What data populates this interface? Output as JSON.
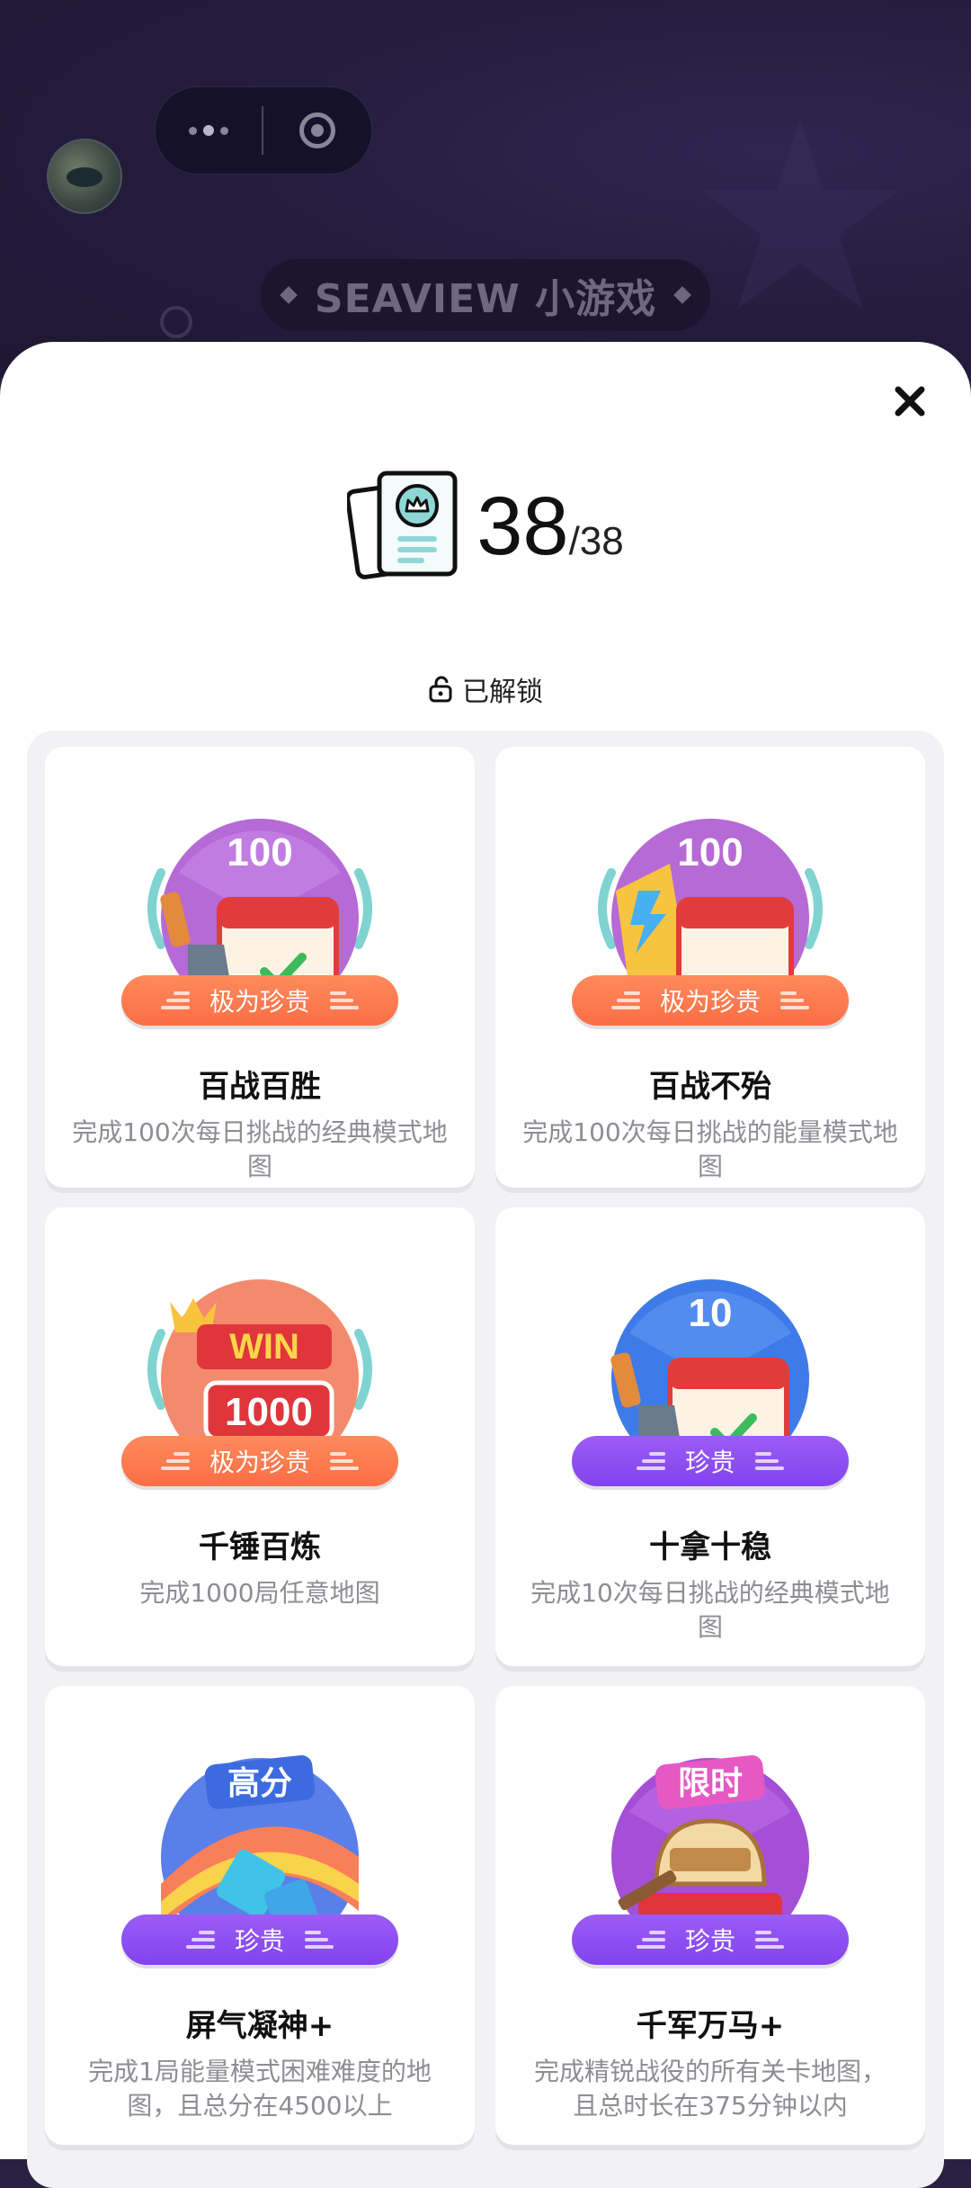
{
  "header": {
    "game_title": "SEAVIEW 小游戏"
  },
  "sheet": {
    "progress": {
      "unlocked": "38",
      "total": "/38"
    },
    "filter_label": "已解锁"
  },
  "achievements": [
    {
      "name": "百战百胜",
      "desc": "完成100次每日挑战的经典模式地图",
      "rarity": "极为珍贵",
      "badge_label": "100",
      "color": "#fb6e45"
    },
    {
      "name": "百战不殆",
      "desc": "完成100次每日挑战的能量模式地图",
      "rarity": "极为珍贵",
      "badge_label": "100",
      "color": "#fb6e45"
    },
    {
      "name": "千锤百炼",
      "desc": "完成1000局任意地图",
      "rarity": "极为珍贵",
      "badge_label": "1000",
      "badge_label2": "WIN",
      "color": "#fb6e45"
    },
    {
      "name": "十拿十稳",
      "desc": "完成10次每日挑战的经典模式地图",
      "rarity": "珍贵",
      "badge_label": "10",
      "color": "#8243ee"
    },
    {
      "name": "屏气凝神+",
      "desc": "完成1局能量模式困难难度的地图，且总分在4500以上",
      "rarity": "珍贵",
      "badge_label": "高分",
      "color": "#8243ee"
    },
    {
      "name": "千军万马+",
      "desc": "完成精锐战役的所有关卡地图，且总时长在375分钟以内",
      "rarity": "珍贵",
      "badge_label": "限时",
      "color": "#8243ee"
    }
  ]
}
